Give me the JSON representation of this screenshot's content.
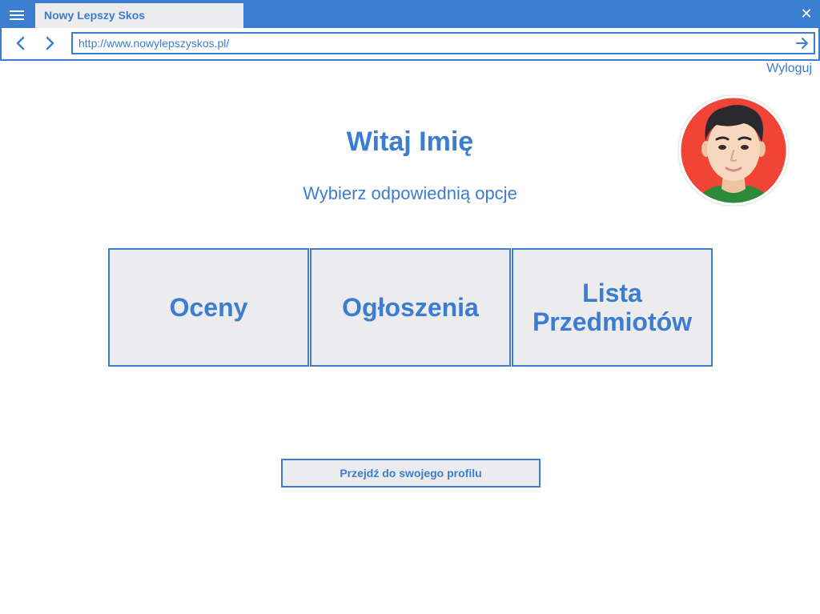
{
  "browser": {
    "tab_title": "Nowy Lepszy Skos",
    "url": "http://www.nowylepszyskos.pl/",
    "close_glyph": "✕",
    "icons": {
      "menu": "menu-icon",
      "back": "chevron-left-icon",
      "forward": "chevron-right-icon",
      "go": "arrow-right-icon",
      "close": "close-icon"
    }
  },
  "header": {
    "logout_label": "Wyloguj"
  },
  "main": {
    "welcome_title": "Witaj Imię",
    "subtitle": "Wybierz odpowiednią opcje",
    "options": [
      {
        "lines": [
          "Oceny"
        ]
      },
      {
        "lines": [
          "Ogłoszenia"
        ]
      },
      {
        "lines": [
          "Lista",
          "Przedmiotów"
        ]
      }
    ],
    "profile_button_label": "Przejdź do swojego profilu"
  },
  "colors": {
    "accent": "#3b7dd0",
    "tile_background": "#ececee",
    "avatar_background": "#f04437"
  }
}
